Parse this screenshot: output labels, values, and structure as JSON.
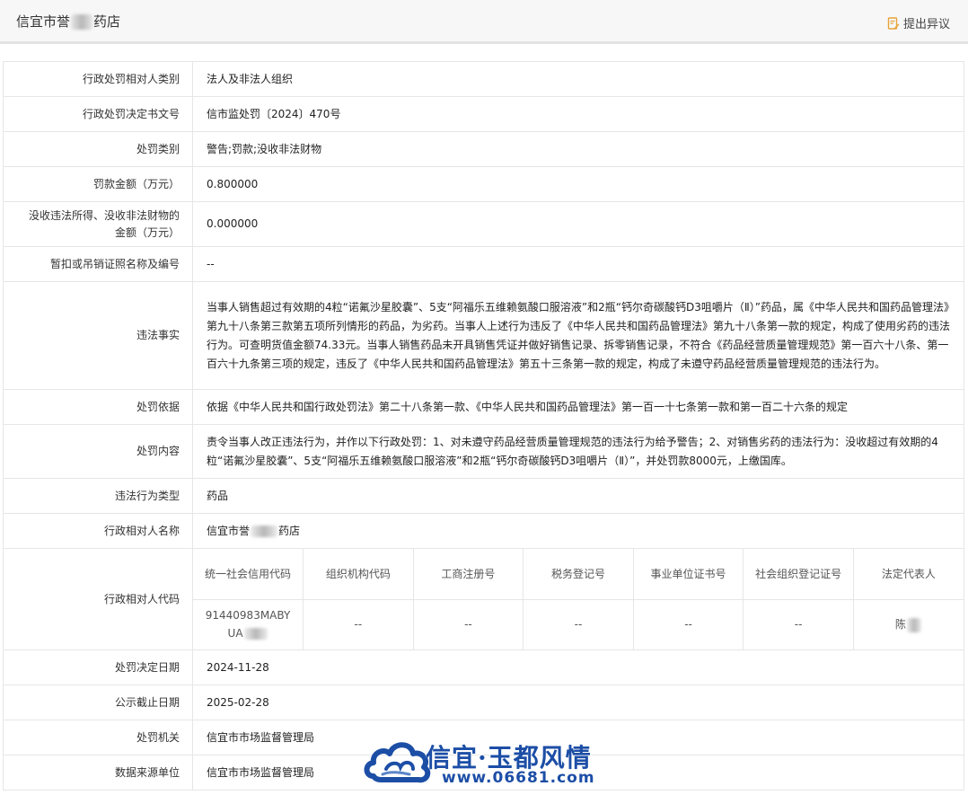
{
  "header": {
    "title_part1": "信宜市誉",
    "title_part2": "药店",
    "objection_label": "提出异议",
    "objection_icon": "objection-icon"
  },
  "rows": {
    "party_type": {
      "label": "行政处罚相对人类别",
      "value": "法人及非法人组织"
    },
    "decision_no": {
      "label": "行政处罚决定书文号",
      "value": "信市监处罚〔2024〕470号"
    },
    "penalty_type": {
      "label": "处罚类别",
      "value": "警告;罚款;没收非法财物"
    },
    "fine": {
      "label": "罚款金额（万元）",
      "value": "0.800000"
    },
    "confiscation": {
      "label": "没收违法所得、没收非法财物的金额（万元）",
      "value": "0.000000"
    },
    "license": {
      "label": "暂扣或吊销证照名称及编号",
      "value": "--"
    },
    "facts": {
      "label": "违法事实",
      "value": "当事人销售超过有效期的4粒“诺氟沙星胶囊”、5支“阿福乐五维赖氨酸口服溶液”和2瓶“钙尔奇碳酸钙D3咀嚼片（Ⅱ）”药品，属《中华人民共和国药品管理法》第九十八条第三款第五项所列情形的药品，为劣药。当事人上述行为违反了《中华人民共和国药品管理法》第九十八条第一款的规定，构成了使用劣药的违法行为。可查明货值金额74.33元。当事人销售药品未开具销售凭证并做好销售记录、拆零销售记录，不符合《药品经营质量管理规范》第一百六十八条、第一百六十九条第三项的规定，违反了《中华人民共和国药品管理法》第五十三条第一款的规定，构成了未遵守药品经营质量管理规范的违法行为。"
    },
    "basis": {
      "label": "处罚依据",
      "value": "依据《中华人民共和国行政处罚法》第二十八条第一款、《中华人民共和国药品管理法》第一百一十七条第一款和第一百二十六条的规定"
    },
    "content": {
      "label": "处罚内容",
      "value": "责令当事人改正违法行为，并作以下行政处罚：1、对未遵守药品经营质量管理规范的违法行为给予警告；2、对销售劣药的违法行为：没收超过有效期的4粒“诺氟沙星胶囊”、5支“阿福乐五维赖氨酸口服溶液”和2瓶“钙尔奇碳酸钙D3咀嚼片（Ⅱ）”，并处罚款8000元，上缴国库。"
    },
    "violation_type": {
      "label": "违法行为类型",
      "value": "药品"
    },
    "party_name": {
      "label": "行政相对人名称",
      "value_part1": "信宜市誉",
      "value_part2": "药店"
    },
    "party_code": {
      "label": "行政相对人代码",
      "headers": [
        "统一社会信用代码",
        "组织机构代码",
        "工商注册号",
        "税务登记号",
        "事业单位证书号",
        "社会组织登记证号",
        "法定代表人"
      ],
      "credit_code_part1": "91440983MABY",
      "credit_code_part2": "UA",
      "org_code": "--",
      "business_reg": "--",
      "tax_reg": "--",
      "institution_cert": "--",
      "social_org_cert": "--",
      "legal_rep": "陈"
    },
    "decision_date": {
      "label": "处罚决定日期",
      "value": "2024-11-28"
    },
    "publish_deadline": {
      "label": "公示截止日期",
      "value": "2025-02-28"
    },
    "authority": {
      "label": "处罚机关",
      "value": "信宜市市场监督管理局"
    },
    "data_source": {
      "label": "数据来源单位",
      "value": "信宜市市场监督管理局"
    }
  },
  "watermark": {
    "text": "信宜·玉都风情",
    "url": "www.06681.com",
    "icon": "cloud-logo-icon",
    "color": "#1c4ea6"
  }
}
